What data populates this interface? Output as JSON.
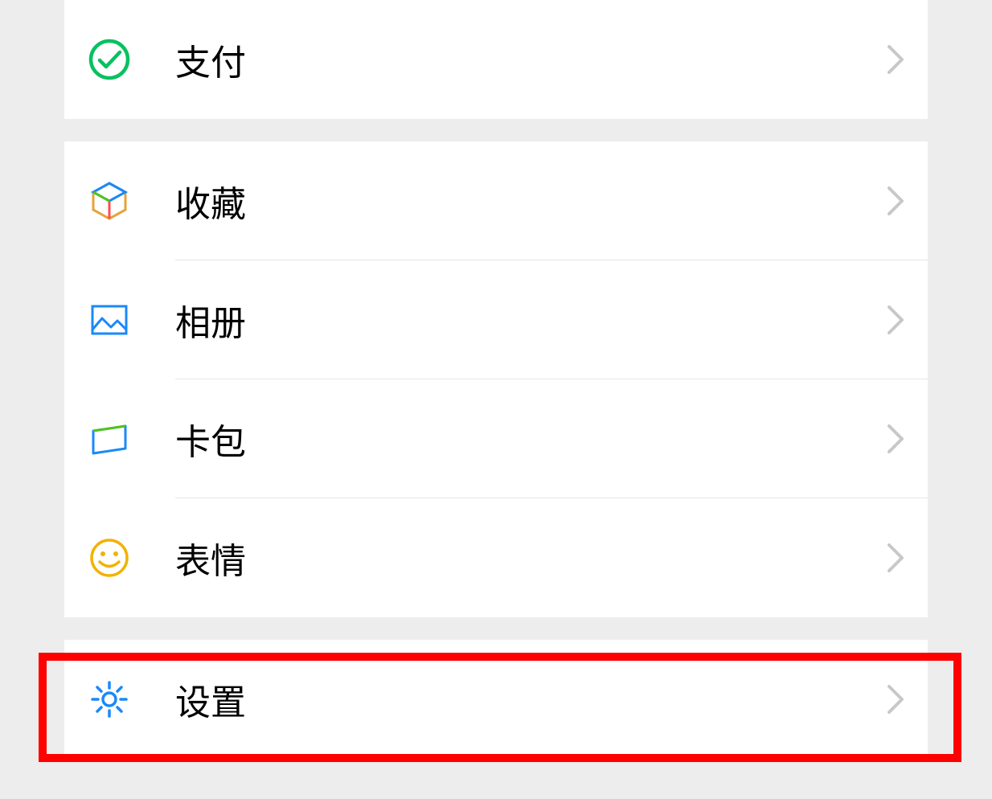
{
  "menu": {
    "group1": [
      {
        "id": "pay",
        "label": "支付"
      }
    ],
    "group2": [
      {
        "id": "favorites",
        "label": "收藏"
      },
      {
        "id": "album",
        "label": "相册"
      },
      {
        "id": "cards",
        "label": "卡包"
      },
      {
        "id": "emoji",
        "label": "表情"
      }
    ],
    "group3": [
      {
        "id": "settings",
        "label": "设置"
      }
    ]
  },
  "highlight": {
    "target": "settings"
  }
}
